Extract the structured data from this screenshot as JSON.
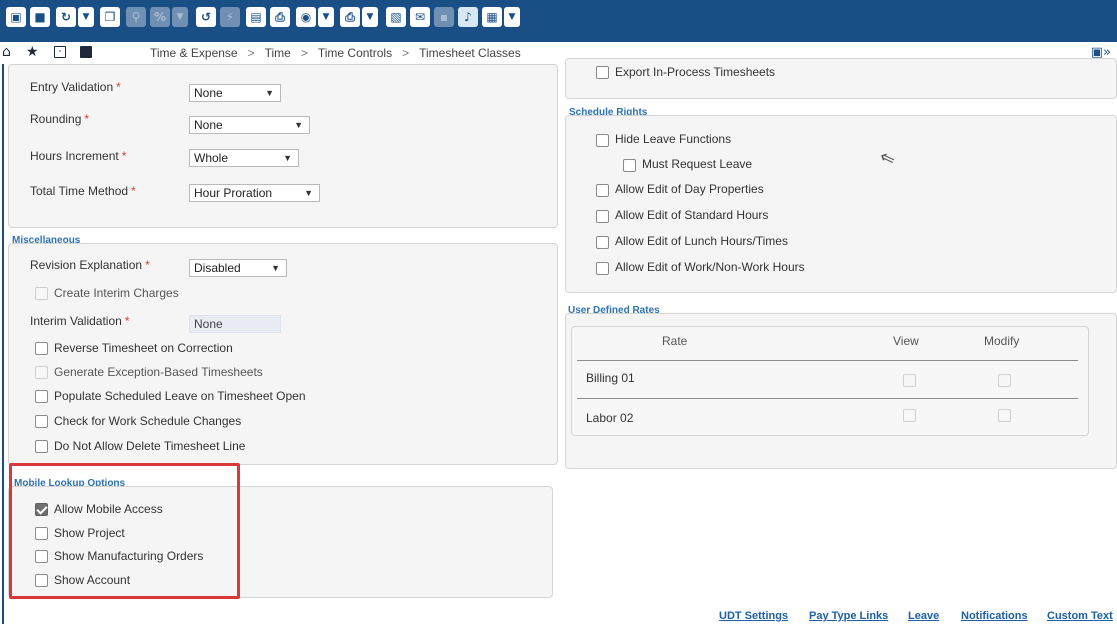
{
  "toolbar": {
    "buttons": [
      {
        "name": "cube-icon",
        "glyph": "▣"
      },
      {
        "name": "save-icon",
        "glyph": "■"
      },
      {
        "name": "refresh-icon",
        "glyph": "↻"
      },
      {
        "name": "refresh-dropdown-icon",
        "glyph": "▼"
      },
      {
        "name": "copy-icon",
        "glyph": "❐"
      },
      {
        "name": "search-icon",
        "glyph": "⚲"
      },
      {
        "name": "percent-icon",
        "glyph": "%"
      },
      {
        "name": "percent-dropdown-icon",
        "glyph": "▼"
      },
      {
        "name": "reset-icon",
        "glyph": "↺"
      },
      {
        "name": "lightning-icon",
        "glyph": "⚡"
      },
      {
        "name": "document-icon",
        "glyph": "▤"
      },
      {
        "name": "print-preview-icon",
        "glyph": "⎙"
      },
      {
        "name": "view-icon",
        "glyph": "◉"
      },
      {
        "name": "view-dropdown-icon",
        "glyph": "▼"
      },
      {
        "name": "printer-icon",
        "glyph": "⎙"
      },
      {
        "name": "printer-dropdown-icon",
        "glyph": "▼"
      },
      {
        "name": "attachment-icon",
        "glyph": "▧"
      },
      {
        "name": "comment-icon",
        "glyph": "✉"
      },
      {
        "name": "disk-icon",
        "glyph": "▪"
      },
      {
        "name": "microphone-icon",
        "glyph": "♪"
      },
      {
        "name": "export-icon",
        "glyph": "▦"
      },
      {
        "name": "export-dropdown-icon",
        "glyph": "▼"
      }
    ]
  },
  "nav": {
    "home_icon": "⌂",
    "star_icon": "★",
    "breadcrumbs": [
      "Time & Expense",
      "Time",
      "Time Controls",
      "Timesheet Classes"
    ],
    "separator": ">"
  },
  "left_top": {
    "fields": [
      {
        "label": "Entry Validation",
        "value": "None"
      },
      {
        "label": "Rounding",
        "value": "None"
      },
      {
        "label": "Hours Increment",
        "value": "Whole"
      },
      {
        "label": "Total Time Method",
        "value": "Hour Proration"
      }
    ]
  },
  "miscellaneous": {
    "title": "Miscellaneous",
    "revision_label": "Revision Explanation",
    "revision_value": "Disabled",
    "create_interim": "Create Interim Charges",
    "interim_label": "Interim Validation",
    "interim_value": "None",
    "checkboxes": [
      "Reverse Timesheet on Correction",
      "Generate Exception-Based Timesheets",
      "Populate Scheduled Leave on Timesheet Open",
      "Check for Work Schedule Changes",
      "Do Not Allow Delete Timesheet Line"
    ]
  },
  "mobile": {
    "title": "Mobile Lookup Options",
    "options": [
      {
        "label": "Allow Mobile Access",
        "checked": true
      },
      {
        "label": "Show Project",
        "checked": false
      },
      {
        "label": "Show Manufacturing Orders",
        "checked": false
      },
      {
        "label": "Show Account",
        "checked": false
      }
    ]
  },
  "right_top": {
    "export_label": "Export In-Process Timesheets"
  },
  "schedule": {
    "title": "Schedule Rights",
    "options": [
      "Hide Leave Functions",
      "Must Request Leave",
      "Allow Edit of Day Properties",
      "Allow Edit of Standard Hours",
      "Allow Edit of Lunch Hours/Times",
      "Allow Edit of Work/Non-Work Hours"
    ]
  },
  "udr": {
    "title": "User Defined Rates",
    "headers": {
      "rate": "Rate",
      "view": "View",
      "modify": "Modify"
    },
    "rows": [
      {
        "rate": "Billing 01"
      },
      {
        "rate": "Labor 02"
      }
    ]
  },
  "footer": {
    "links": [
      "UDT Settings",
      "Pay Type Links",
      "Leave",
      "Notifications",
      "Custom Text"
    ]
  },
  "colors": {
    "toolbar": "#1a4f86",
    "section_title": "#2d72b8",
    "required": "#e03b3b",
    "highlight": "#d9393b",
    "link": "#1e5fa8"
  }
}
